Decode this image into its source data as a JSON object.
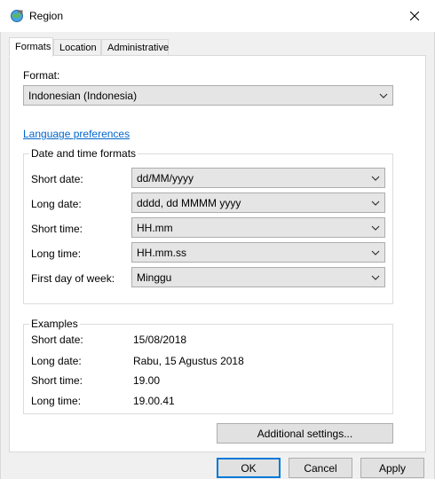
{
  "window": {
    "title": "Region",
    "icon": "globe-region-icon",
    "close_icon": "close-icon"
  },
  "tabs": [
    {
      "label": "Formats",
      "active": true
    },
    {
      "label": "Location",
      "active": false
    },
    {
      "label": "Administrative",
      "active": false
    }
  ],
  "format": {
    "label": "Format:",
    "value": "Indonesian (Indonesia)"
  },
  "language_preferences_link": "Language preferences",
  "date_time_formats": {
    "legend": "Date and time formats",
    "rows": [
      {
        "label": "Short date:",
        "value": "dd/MM/yyyy"
      },
      {
        "label": "Long date:",
        "value": "dddd, dd MMMM yyyy"
      },
      {
        "label": "Short time:",
        "value": "HH.mm"
      },
      {
        "label": "Long time:",
        "value": "HH.mm.ss"
      },
      {
        "label": "First day of week:",
        "value": "Minggu"
      }
    ]
  },
  "examples": {
    "legend": "Examples",
    "rows": [
      {
        "label": "Short date:",
        "value": "15/08/2018"
      },
      {
        "label": "Long date:",
        "value": "Rabu, 15 Agustus 2018"
      },
      {
        "label": "Short time:",
        "value": "19.00"
      },
      {
        "label": "Long time:",
        "value": "19.00.41"
      }
    ]
  },
  "additional_settings_button": "Additional settings...",
  "buttons": {
    "ok": "OK",
    "cancel": "Cancel",
    "apply": "Apply"
  },
  "colors": {
    "link": "#0066cc",
    "default_button_border": "#0078d7",
    "dialog_bg": "#f0f0f0"
  }
}
